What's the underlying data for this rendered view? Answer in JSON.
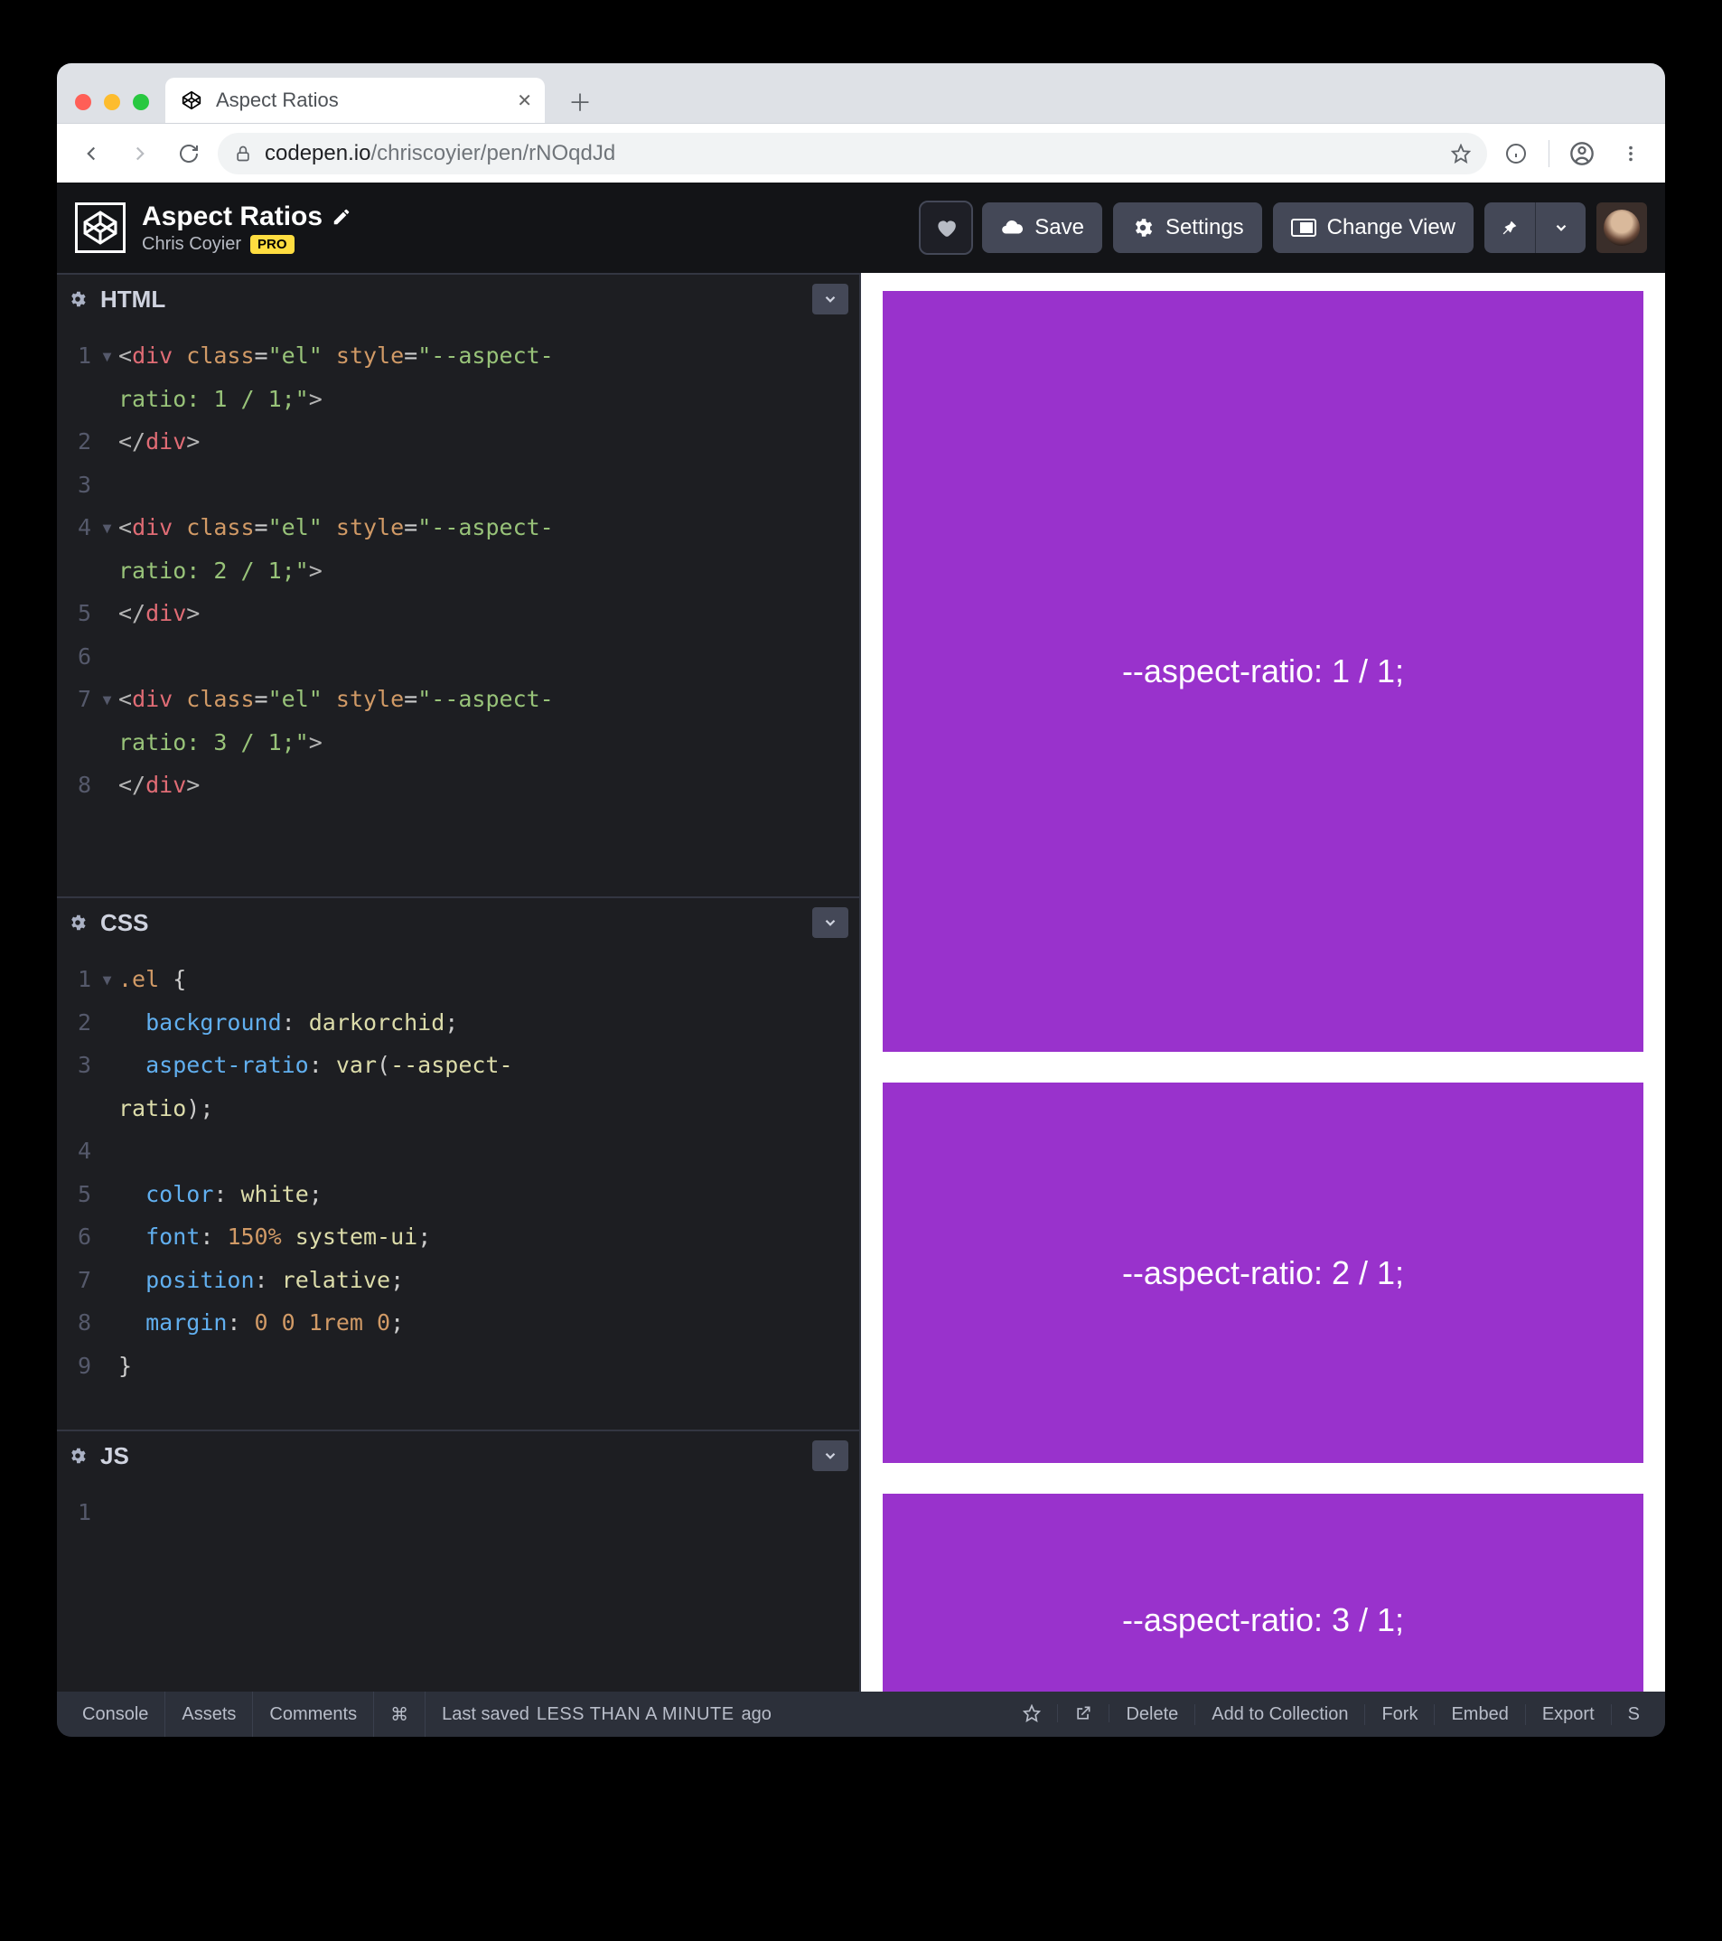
{
  "browser": {
    "tab_title": "Aspect Ratios",
    "url_host": "codepen.io",
    "url_path": "/chriscoyier/pen/rNOqdJd"
  },
  "header": {
    "pen_title": "Aspect Ratios",
    "author": "Chris Coyier",
    "pro_badge": "PRO",
    "save_label": "Save",
    "settings_label": "Settings",
    "change_view_label": "Change View"
  },
  "panels": {
    "html_label": "HTML",
    "css_label": "CSS",
    "js_label": "JS"
  },
  "html_code": [
    {
      "n": "1",
      "fold": "▾",
      "html": "<span class='tag'>&lt;</span><span class='name'>div</span> <span class='attr'>class</span><span class='punc'>=</span><span class='str'>\"el\"</span> <span class='attr'>style</span><span class='punc'>=</span><span class='str'>\"--aspect-</span>"
    },
    {
      "n": "",
      "fold": "",
      "html": "<span class='str'>ratio: 1 / 1;\"</span><span class='tag'>&gt;</span>"
    },
    {
      "n": "2",
      "fold": "",
      "html": "<span class='tag'>&lt;/</span><span class='name'>div</span><span class='tag'>&gt;</span>"
    },
    {
      "n": "3",
      "fold": "",
      "html": ""
    },
    {
      "n": "4",
      "fold": "▾",
      "html": "<span class='tag'>&lt;</span><span class='name'>div</span> <span class='attr'>class</span><span class='punc'>=</span><span class='str'>\"el\"</span> <span class='attr'>style</span><span class='punc'>=</span><span class='str'>\"--aspect-</span>"
    },
    {
      "n": "",
      "fold": "",
      "html": "<span class='str'>ratio: 2 / 1;\"</span><span class='tag'>&gt;</span>"
    },
    {
      "n": "5",
      "fold": "",
      "html": "<span class='tag'>&lt;/</span><span class='name'>div</span><span class='tag'>&gt;</span>"
    },
    {
      "n": "6",
      "fold": "",
      "html": ""
    },
    {
      "n": "7",
      "fold": "▾",
      "html": "<span class='tag'>&lt;</span><span class='name'>div</span> <span class='attr'>class</span><span class='punc'>=</span><span class='str'>\"el\"</span> <span class='attr'>style</span><span class='punc'>=</span><span class='str'>\"--aspect-</span>"
    },
    {
      "n": "",
      "fold": "",
      "html": "<span class='str'>ratio: 3 / 1;\"</span><span class='tag'>&gt;</span>"
    },
    {
      "n": "8",
      "fold": "",
      "html": "<span class='tag'>&lt;/</span><span class='name'>div</span><span class='tag'>&gt;</span>"
    }
  ],
  "css_code": [
    {
      "n": "1",
      "fold": "▾",
      "html": "<span class='sel'>.el</span> <span class='punc'>{</span>"
    },
    {
      "n": "2",
      "fold": "",
      "html": "  <span class='prop'>background</span><span class='punc'>:</span> <span class='val'>darkorchid</span><span class='punc'>;</span>"
    },
    {
      "n": "3",
      "fold": "",
      "html": "  <span class='prop'>aspect-ratio</span><span class='punc'>:</span> <span class='val'>var</span><span class='punc'>(</span><span class='val'>--aspect-</span>"
    },
    {
      "n": "",
      "fold": "",
      "html": "<span class='val'>ratio</span><span class='punc'>);</span>"
    },
    {
      "n": "4",
      "fold": "",
      "html": ""
    },
    {
      "n": "5",
      "fold": "",
      "html": "  <span class='prop'>color</span><span class='punc'>:</span> <span class='val'>white</span><span class='punc'>;</span>"
    },
    {
      "n": "6",
      "fold": "",
      "html": "  <span class='prop'>font</span><span class='punc'>:</span> <span class='num'>150%</span> <span class='val'>system-ui</span><span class='punc'>;</span>"
    },
    {
      "n": "7",
      "fold": "",
      "html": "  <span class='prop'>position</span><span class='punc'>:</span> <span class='val'>relative</span><span class='punc'>;</span>"
    },
    {
      "n": "8",
      "fold": "",
      "html": "  <span class='prop'>margin</span><span class='punc'>:</span> <span class='num'>0 0 1rem 0</span><span class='punc'>;</span>"
    },
    {
      "n": "9",
      "fold": "",
      "html": "<span class='punc'>}</span>"
    }
  ],
  "js_code": [
    {
      "n": "1",
      "fold": "",
      "html": ""
    }
  ],
  "preview": {
    "box1": "--aspect-ratio: 1 / 1;",
    "box2": "--aspect-ratio: 2 / 1;",
    "box3": "--aspect-ratio: 3 / 1;"
  },
  "footer": {
    "console": "Console",
    "assets": "Assets",
    "comments": "Comments",
    "shortcut": "⌘",
    "saved_prefix": "Last saved ",
    "saved_time": "LESS THAN A MINUTE",
    "saved_suffix": " ago",
    "delete": "Delete",
    "add": "Add to Collection",
    "fork": "Fork",
    "embed": "Embed",
    "export": "Export",
    "share_initial": "S"
  }
}
